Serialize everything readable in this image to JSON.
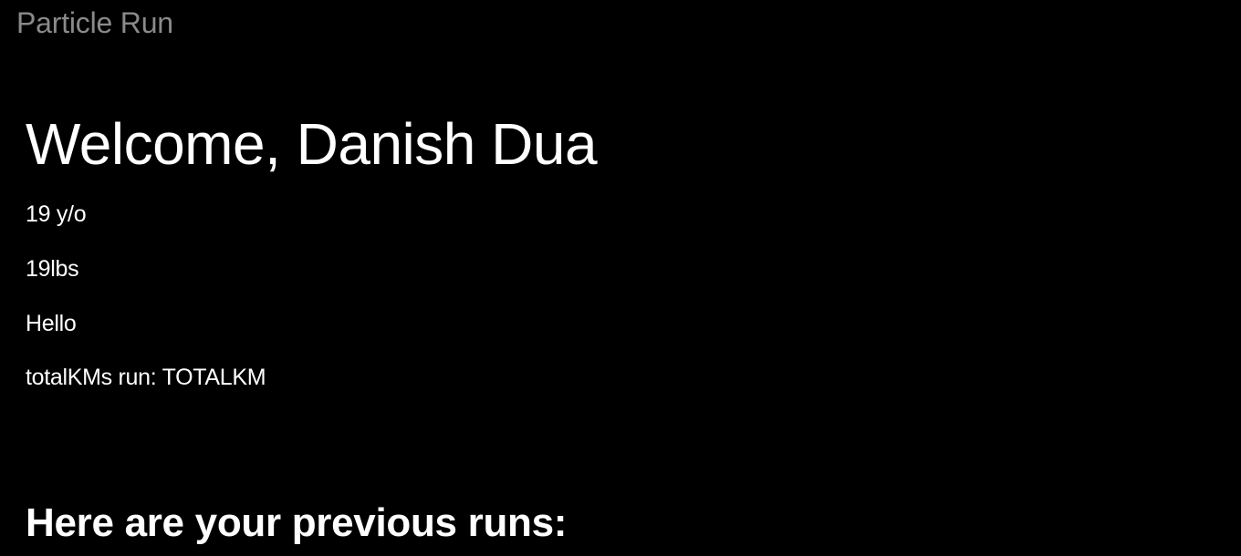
{
  "app": {
    "brand": "Particle Run"
  },
  "profile": {
    "welcome": "Welcome, Danish Dua",
    "age": "19 y/o",
    "weight": "19lbs",
    "greeting": "Hello",
    "total_km": "totalKMs run: TOTALKM"
  },
  "runs": {
    "heading": "Here are your previous runs:"
  },
  "colors": {
    "background": "#000000",
    "text": "#ffffff",
    "brand": "#8a8a8a"
  }
}
